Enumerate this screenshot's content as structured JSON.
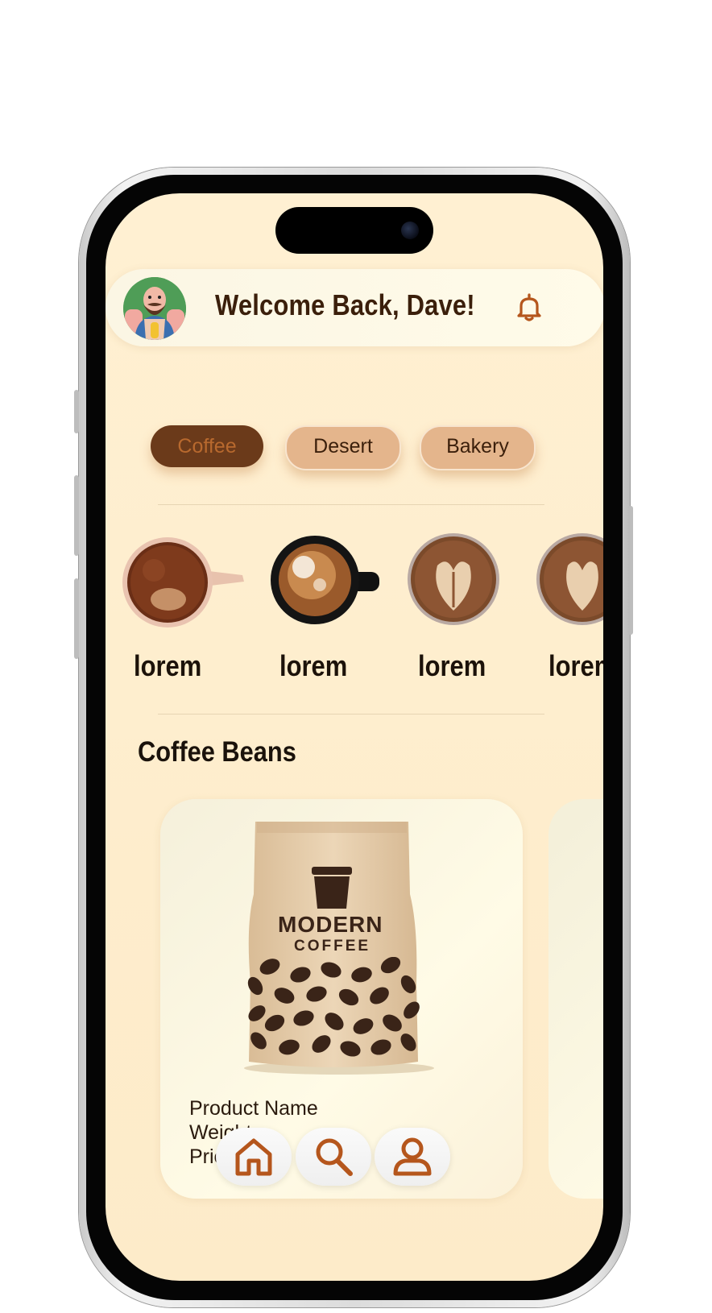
{
  "header": {
    "welcome_text": "Welcome Back, Dave!"
  },
  "categories": [
    {
      "label": "Coffee",
      "selected": true
    },
    {
      "label": "Desert",
      "selected": false
    },
    {
      "label": "Bakery",
      "selected": false
    }
  ],
  "drinks": [
    {
      "label": "lorem"
    },
    {
      "label": "lorem"
    },
    {
      "label": "lorem"
    },
    {
      "label": "lorem"
    }
  ],
  "section": {
    "title": "Coffee Beans"
  },
  "product": {
    "brand_line1": "MODERN",
    "brand_line2": "COFFEE",
    "name": "Product Name",
    "weight": "Weight",
    "price": "Price"
  },
  "nav": {
    "items": [
      "home-icon",
      "search-icon",
      "profile-icon"
    ]
  },
  "colors": {
    "background": "#fdebc9",
    "accent": "#b5561c",
    "text_dark": "#3b1f0b",
    "pill_selected": "#6b3a1a",
    "pill_default": "#e4b58c"
  }
}
